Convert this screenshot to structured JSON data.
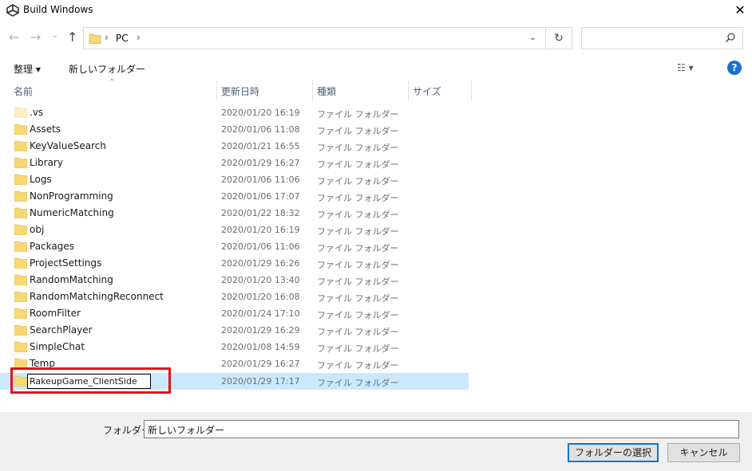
{
  "window": {
    "title": "Build Windows",
    "close_glyph": "✕"
  },
  "nav": {
    "back_glyph": "←",
    "forward_glyph": "→",
    "recent_glyph": "⌄",
    "up_glyph": "↑",
    "breadcrumb_sep": "›",
    "breadcrumb": "PC",
    "dropdown_glyph": "⌄",
    "refresh_glyph": "↻",
    "search_placeholder": ""
  },
  "toolbar": {
    "organize_label": "整理 ▾",
    "new_folder_label": "新しいフォルダー",
    "view_glyph": "☷ ▾",
    "help_glyph": "?"
  },
  "columns": {
    "name": "名前",
    "date": "更新日時",
    "type": "種類",
    "size": "サイズ",
    "sort_glyph": "^"
  },
  "files": [
    {
      "name": ".vs",
      "date": "2020/01/20 16:19",
      "type": "ファイル フォルダー"
    },
    {
      "name": "Assets",
      "date": "2020/01/06 11:08",
      "type": "ファイル フォルダー"
    },
    {
      "name": "KeyValueSearch",
      "date": "2020/01/21 16:55",
      "type": "ファイル フォルダー"
    },
    {
      "name": "Library",
      "date": "2020/01/29 16:27",
      "type": "ファイル フォルダー"
    },
    {
      "name": "Logs",
      "date": "2020/01/06 11:06",
      "type": "ファイル フォルダー"
    },
    {
      "name": "NonProgramming",
      "date": "2020/01/06 17:07",
      "type": "ファイル フォルダー"
    },
    {
      "name": "NumericMatching",
      "date": "2020/01/22 18:32",
      "type": "ファイル フォルダー"
    },
    {
      "name": "obj",
      "date": "2020/01/20 16:19",
      "type": "ファイル フォルダー"
    },
    {
      "name": "Packages",
      "date": "2020/01/06 11:06",
      "type": "ファイル フォルダー"
    },
    {
      "name": "ProjectSettings",
      "date": "2020/01/29 16:26",
      "type": "ファイル フォルダー"
    },
    {
      "name": "RandomMatching",
      "date": "2020/01/20 13:40",
      "type": "ファイル フォルダー"
    },
    {
      "name": "RandomMatchingReconnect",
      "date": "2020/01/20 16:08",
      "type": "ファイル フォルダー"
    },
    {
      "name": "RoomFilter",
      "date": "2020/01/24 17:10",
      "type": "ファイル フォルダー"
    },
    {
      "name": "SearchPlayer",
      "date": "2020/01/29 16:29",
      "type": "ファイル フォルダー"
    },
    {
      "name": "SimpleChat",
      "date": "2020/01/08 14:59",
      "type": "ファイル フォルダー"
    },
    {
      "name": "Temp",
      "date": "2020/01/29 16:27",
      "type": "ファイル フォルダー"
    }
  ],
  "renaming": {
    "name": "RakeupGame_ClientSide",
    "date": "2020/01/29 17:17",
    "type": "ファイル フォルダー"
  },
  "footer": {
    "folder_label": "フォルダー:",
    "folder_value": "新しいフォルダー",
    "select_button": "フォルダーの選択",
    "cancel_button": "キャンセル"
  },
  "colors": {
    "selection": "#cce8ff",
    "highlight_border": "#e01414",
    "accent": "#0078d7"
  }
}
